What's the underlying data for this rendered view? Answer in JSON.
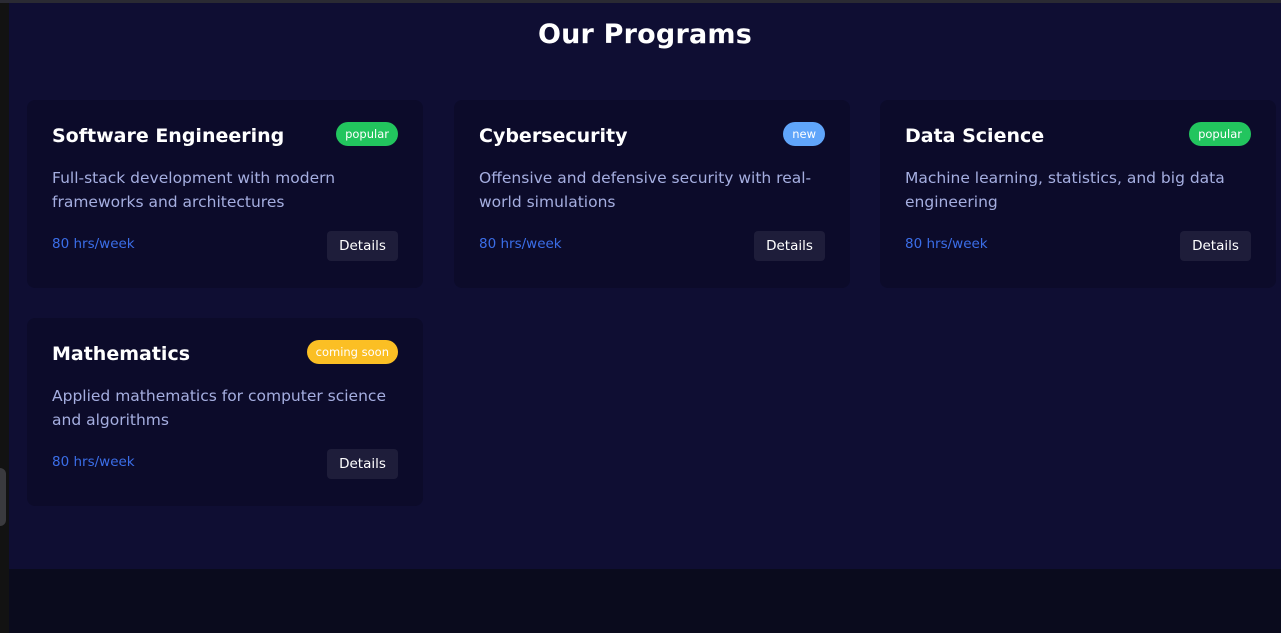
{
  "section": {
    "title": "Our Programs"
  },
  "programs": [
    {
      "title": "Software Engineering",
      "badge": "popular",
      "description": "Full-stack development with modern frameworks and architectures",
      "hours": "80 hrs/week",
      "button": "Details"
    },
    {
      "title": "Cybersecurity",
      "badge": "new",
      "description": "Offensive and defensive security with real-world simulations",
      "hours": "80 hrs/week",
      "button": "Details"
    },
    {
      "title": "Data Science",
      "badge": "popular",
      "description": "Machine learning, statistics, and big data engineering",
      "hours": "80 hrs/week",
      "button": "Details"
    },
    {
      "title": "Mathematics",
      "badge": "coming soon",
      "description": "Applied mathematics for computer science and algorithms",
      "hours": "80 hrs/week",
      "button": "Details"
    }
  ],
  "colors": {
    "background": "#0f0e33",
    "card": "#0c0b2a",
    "badge_popular": "#22c55e",
    "badge_new": "#60a5fa",
    "badge_coming_soon": "#fbbf24",
    "hours_text": "#3b6ee8"
  }
}
